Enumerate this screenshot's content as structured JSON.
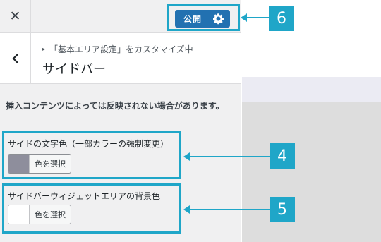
{
  "topbar": {
    "close_symbol": "✕",
    "publish_label": "公開",
    "publish_icon": "gear-icon"
  },
  "header": {
    "back_icon": "chevron-left-icon",
    "breadcrumb": "「基本エリア設定」をカスタマイズ中",
    "title": "サイドバー"
  },
  "notice": "挿入コンテンツによっては反映されない場合があります。",
  "controls": [
    {
      "label": "サイドの文字色（一部カラーの強制変更）",
      "button": "色を選択",
      "swatch": "#8e8e9c"
    },
    {
      "label": "サイドバーウィジェットエリアの背景色",
      "button": "色を選択",
      "swatch": "#ffffff"
    }
  ],
  "callouts": [
    "6",
    "4",
    "5"
  ],
  "colors": {
    "accent": "#1fa6c8",
    "publish": "#2271b1"
  }
}
